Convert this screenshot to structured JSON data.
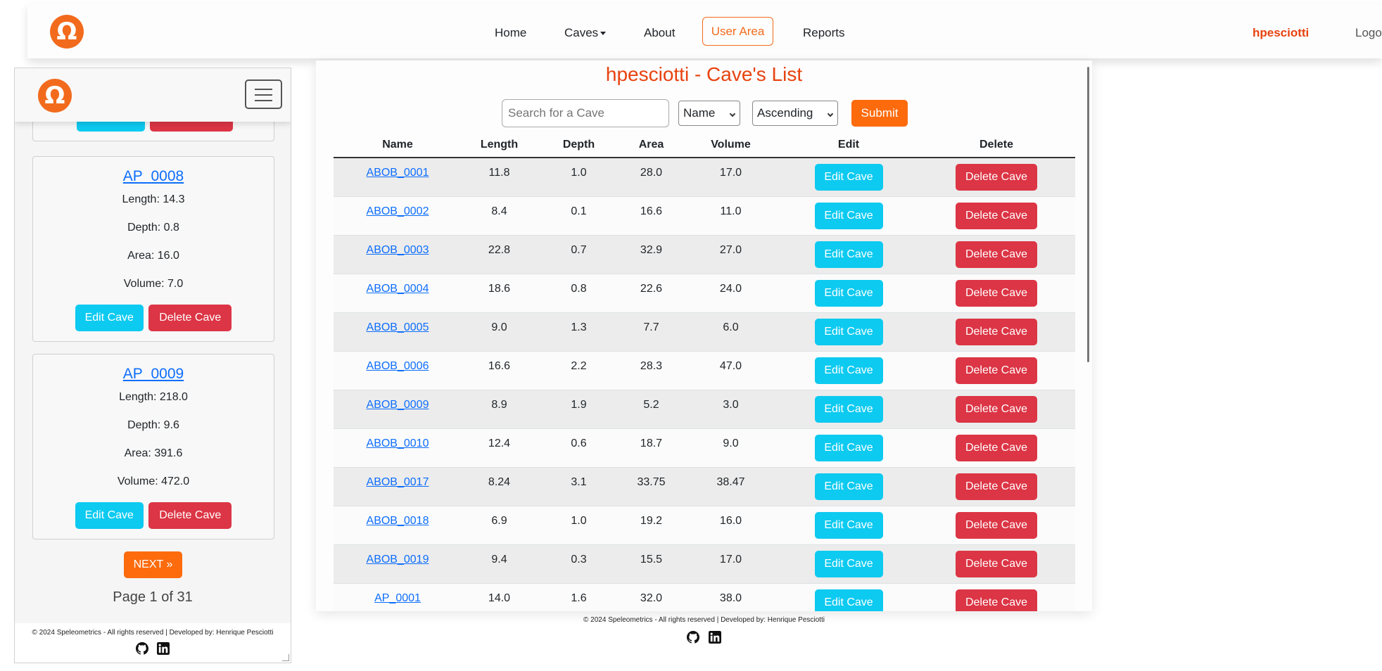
{
  "nav": {
    "items": [
      "Home",
      "Caves",
      "About",
      "User Area",
      "Reports"
    ],
    "username": "hpesciotti",
    "logout": "Logout"
  },
  "main": {
    "title": "hpesciotti - Cave's List",
    "search_placeholder": "Search for a Cave",
    "sort_field": "Name",
    "sort_order": "Ascending",
    "submit": "Submit",
    "columns": [
      "Name",
      "Length",
      "Depth",
      "Area",
      "Volume",
      "Edit",
      "Delete"
    ],
    "edit_label": "Edit Cave",
    "delete_label": "Delete Cave",
    "rows": [
      {
        "name": "ABOB_0001",
        "length": "11.8",
        "depth": "1.0",
        "area": "28.0",
        "volume": "17.0"
      },
      {
        "name": "ABOB_0002",
        "length": "8.4",
        "depth": "0.1",
        "area": "16.6",
        "volume": "11.0"
      },
      {
        "name": "ABOB_0003",
        "length": "22.8",
        "depth": "0.7",
        "area": "32.9",
        "volume": "27.0"
      },
      {
        "name": "ABOB_0004",
        "length": "18.6",
        "depth": "0.8",
        "area": "22.6",
        "volume": "24.0"
      },
      {
        "name": "ABOB_0005",
        "length": "9.0",
        "depth": "1.3",
        "area": "7.7",
        "volume": "6.0"
      },
      {
        "name": "ABOB_0006",
        "length": "16.6",
        "depth": "2.2",
        "area": "28.3",
        "volume": "47.0"
      },
      {
        "name": "ABOB_0009",
        "length": "8.9",
        "depth": "1.9",
        "area": "5.2",
        "volume": "3.0"
      },
      {
        "name": "ABOB_0010",
        "length": "12.4",
        "depth": "0.6",
        "area": "18.7",
        "volume": "9.0"
      },
      {
        "name": "ABOB_0017",
        "length": "8.24",
        "depth": "3.1",
        "area": "33.75",
        "volume": "38.47"
      },
      {
        "name": "ABOB_0018",
        "length": "6.9",
        "depth": "1.0",
        "area": "19.2",
        "volume": "16.0"
      },
      {
        "name": "ABOB_0019",
        "length": "9.4",
        "depth": "0.3",
        "area": "15.5",
        "volume": "17.0"
      },
      {
        "name": "AP_0001",
        "length": "14.0",
        "depth": "1.6",
        "area": "32.0",
        "volume": "38.0"
      }
    ],
    "footer": "© 2024 Speleometrics - All rights reserved | Developed by: Henrique Pesciotti"
  },
  "mobile": {
    "partial_card": {
      "edit": "Edit Cave",
      "delete": "Delete Cave"
    },
    "cards": [
      {
        "title": "AP_0008",
        "length": "Length: 14.3",
        "depth": "Depth: 0.8",
        "area": "Area: 16.0",
        "volume": "Volume: 7.0",
        "edit": "Edit Cave",
        "delete": "Delete Cave"
      },
      {
        "title": "AP_0009",
        "length": "Length: 218.0",
        "depth": "Depth: 9.6",
        "area": "Area: 391.6",
        "volume": "Volume: 472.0",
        "edit": "Edit Cave",
        "delete": "Delete Cave"
      }
    ],
    "next": "NEXT »",
    "page_info": "Page 1 of 31",
    "footer": "© 2024 Speleometrics - All rights reserved | Developed by: Henrique Pesciotti"
  },
  "colors": {
    "brand": "#f26b1d",
    "accent_orange": "#fd6b0d",
    "title_red": "#e8420f",
    "edit_cyan": "#0dcaf0",
    "delete_red": "#dc3545",
    "link_blue": "#0d6efd"
  },
  "icons": [
    "omega-logo",
    "github-icon",
    "linkedin-icon",
    "hamburger-icon",
    "caret-down-icon"
  ]
}
